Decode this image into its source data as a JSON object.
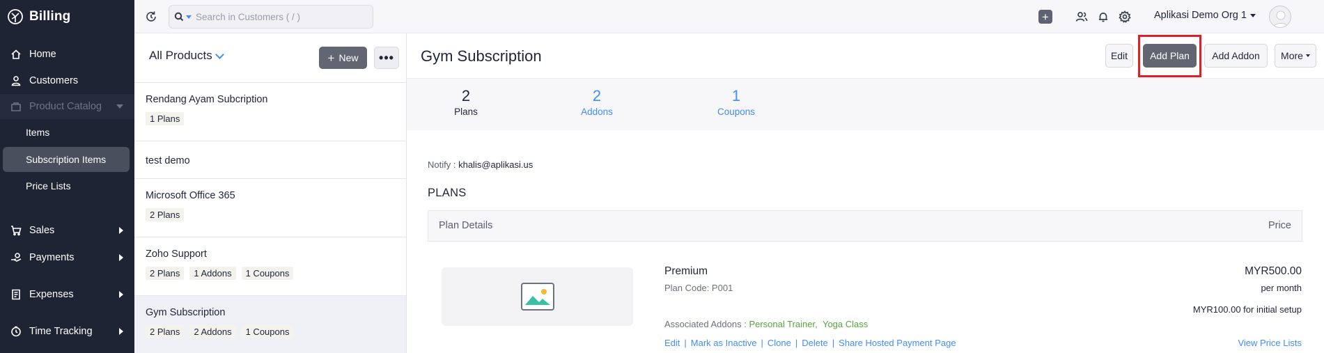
{
  "app": {
    "name": "Billing"
  },
  "sidebar": {
    "home": "Home",
    "customers": "Customers",
    "product_catalog": "Product Catalog",
    "items": "Items",
    "subscription_items": "Subscription Items",
    "price_lists": "Price Lists",
    "sales": "Sales",
    "payments": "Payments",
    "expenses": "Expenses",
    "time_tracking": "Time Tracking"
  },
  "topbar": {
    "search_placeholder": "Search in Customers ( / )",
    "org_name": "Aplikasi Demo Org 1"
  },
  "list": {
    "title": "All Products",
    "new_label": "New",
    "more_label": "•••",
    "items": [
      {
        "name": "Rendang Ayam Subcription",
        "tags": [
          "1 Plans"
        ]
      },
      {
        "name": "test demo",
        "tags": []
      },
      {
        "name": "Microsoft Office 365",
        "tags": [
          "2 Plans"
        ]
      },
      {
        "name": "Zoho Support",
        "tags": [
          "2 Plans",
          "1 Addons",
          "1 Coupons"
        ]
      },
      {
        "name": "Gym Subscription",
        "tags": [
          "2 Plans",
          "2 Addons",
          "1 Coupons"
        ]
      }
    ]
  },
  "detail": {
    "title": "Gym Subscription",
    "buttons": {
      "edit": "Edit",
      "add_plan": "Add Plan",
      "add_addon": "Add Addon",
      "more": "More"
    },
    "stats": [
      {
        "value": "2",
        "label": "Plans"
      },
      {
        "value": "2",
        "label": "Addons"
      },
      {
        "value": "1",
        "label": "Coupons"
      }
    ],
    "notify_label": "Notify :",
    "notify_email": "khalis@aplikasi.us",
    "plans_heading": "PLANS",
    "table": {
      "col_details": "Plan Details",
      "col_price": "Price"
    },
    "plan": {
      "name": "Premium",
      "code": "Plan Code: P001",
      "price": "MYR500.00",
      "period": "per month",
      "setup": "MYR100.00 for initial setup",
      "addons_label": "Associated Addons :",
      "addon_1": "Personal Trainer",
      "addon_sep": ",",
      "addon_2": "Yoga Class",
      "actions": {
        "edit": "Edit",
        "mark_inactive": "Mark as Inactive",
        "clone": "Clone",
        "delete": "Delete",
        "share": "Share Hosted Payment Page"
      },
      "view_price_lists": "View Price Lists"
    }
  },
  "colors": {
    "sidebar_bg": "#1f2435",
    "accent": "#408dfb",
    "highlight": "#e01e2a",
    "addon_green": "#57a33d"
  }
}
